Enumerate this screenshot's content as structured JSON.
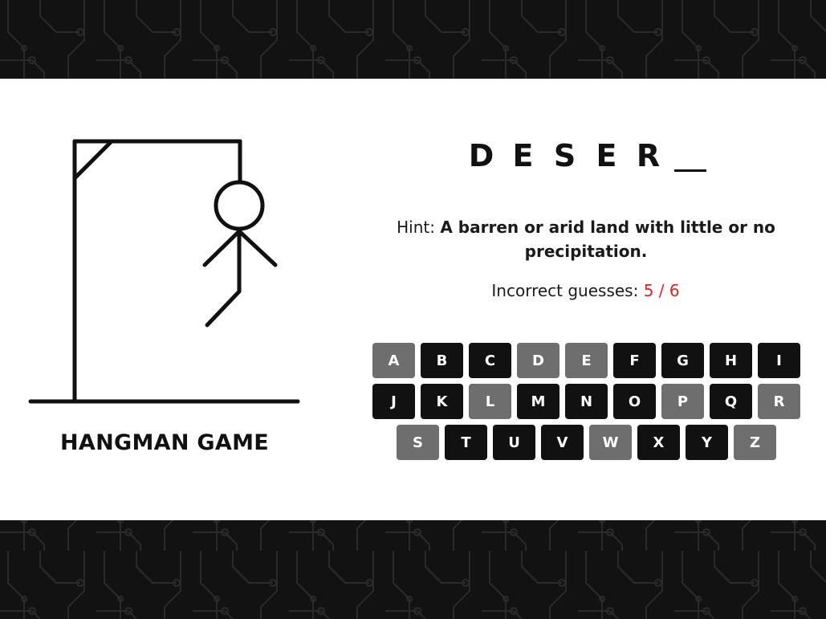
{
  "game": {
    "title": "HANGMAN GAME",
    "word_letters": [
      "D",
      "E",
      "S",
      "E",
      "R",
      ""
    ],
    "hint_label": "Hint:",
    "hint_text": "A barren or arid land with little or no precipitation.",
    "guesses_label": "Incorrect guesses:",
    "guesses_count": "5 / 6",
    "incorrect": 5,
    "max_incorrect": 6
  },
  "colors": {
    "background": "#121212",
    "card": "#ffffff",
    "key_active": "#111111",
    "key_used": "#6e6e6e",
    "guess_count": "#e0231f"
  },
  "keyboard": {
    "keys": [
      {
        "label": "A",
        "used": true
      },
      {
        "label": "B",
        "used": false
      },
      {
        "label": "C",
        "used": false
      },
      {
        "label": "D",
        "used": true
      },
      {
        "label": "E",
        "used": true
      },
      {
        "label": "F",
        "used": false
      },
      {
        "label": "G",
        "used": false
      },
      {
        "label": "H",
        "used": false
      },
      {
        "label": "I",
        "used": false
      },
      {
        "label": "J",
        "used": false
      },
      {
        "label": "K",
        "used": false
      },
      {
        "label": "L",
        "used": true
      },
      {
        "label": "M",
        "used": false
      },
      {
        "label": "N",
        "used": false
      },
      {
        "label": "O",
        "used": false
      },
      {
        "label": "P",
        "used": true
      },
      {
        "label": "Q",
        "used": false
      },
      {
        "label": "R",
        "used": true
      },
      {
        "label": "S",
        "used": true
      },
      {
        "label": "T",
        "used": false
      },
      {
        "label": "U",
        "used": false
      },
      {
        "label": "V",
        "used": false
      },
      {
        "label": "W",
        "used": true
      },
      {
        "label": "X",
        "used": false
      },
      {
        "label": "Y",
        "used": false
      },
      {
        "label": "Z",
        "used": true
      }
    ]
  }
}
